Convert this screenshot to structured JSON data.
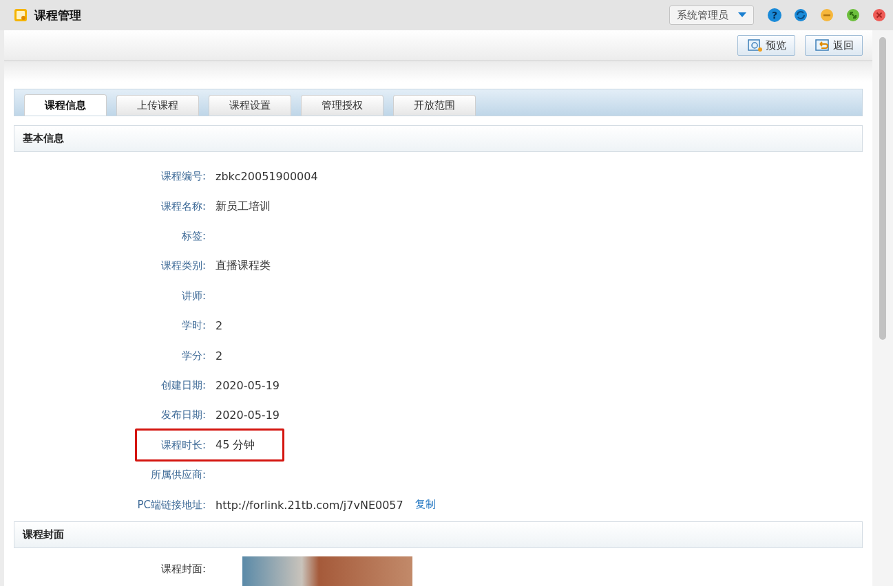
{
  "window": {
    "title": "课程管理",
    "user_menu": "系统管理员",
    "help_glyph": "?"
  },
  "toolbar": {
    "buttons": [
      {
        "label": "预览",
        "kind": "preview"
      },
      {
        "label": "返回",
        "kind": "back"
      }
    ]
  },
  "tabs": [
    {
      "label": "课程信息",
      "selected": true
    },
    {
      "label": "上传课程",
      "selected": false
    },
    {
      "label": "课程设置",
      "selected": false
    },
    {
      "label": "管理授权",
      "selected": false
    },
    {
      "label": "开放范围",
      "selected": false
    }
  ],
  "basic_info": {
    "title": "基本信息",
    "fields": [
      {
        "label": "课程编号:",
        "value": "zbkc20051900004",
        "highlighted": false
      },
      {
        "label": "课程名称:",
        "value": "新员工培训",
        "highlighted": false
      },
      {
        "label": "标签:",
        "highlighted": false
      },
      {
        "label": "课程类别:",
        "value": "直播课程类",
        "highlighted": false
      },
      {
        "label": "讲师:",
        "highlighted": false
      },
      {
        "label": "学时:",
        "value": "2",
        "highlighted": false
      },
      {
        "label": "学分:",
        "value": "2",
        "highlighted": false
      },
      {
        "label": "创建日期:",
        "value": "2020-05-19",
        "highlighted": false
      },
      {
        "label": "发布日期:",
        "value": "2020-05-19",
        "highlighted": false
      },
      {
        "label": "课程时长:",
        "value": "45 分钟",
        "highlighted": true
      },
      {
        "label": "所属供应商:",
        "highlighted": false
      },
      {
        "label": "PC端链接地址:",
        "value": "http://forlink.21tb.com/j7vNE0057",
        "link": "复制",
        "highlighted": false
      }
    ]
  },
  "cover": {
    "title": "课程封面",
    "label": "课程封面:"
  }
}
